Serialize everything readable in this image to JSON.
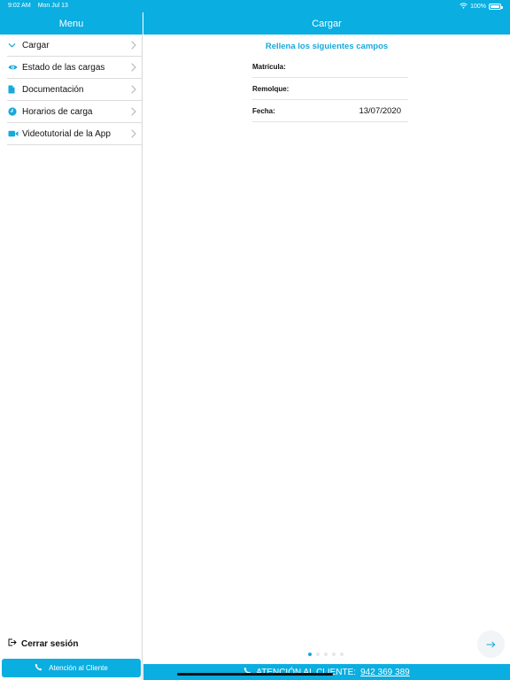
{
  "status_bar": {
    "time": "9:02 AM",
    "date": "Mon Jul 13",
    "battery": "100%"
  },
  "sidebar": {
    "title": "Menu",
    "items": [
      {
        "label": "Cargar",
        "icon": "chevron-down-icon"
      },
      {
        "label": "Estado de las cargas",
        "icon": "eye-icon"
      },
      {
        "label": "Documentación",
        "icon": "document-icon"
      },
      {
        "label": "Horarios de carga",
        "icon": "clock-icon"
      },
      {
        "label": "Videotutorial de la App",
        "icon": "video-camera-icon"
      }
    ],
    "logout_label": "Cerrar sesión",
    "support_label": "Atención al Cliente"
  },
  "main": {
    "title": "Cargar",
    "form_title": "Rellena los siguientes campos",
    "fields": [
      {
        "label": "Matrícula:",
        "value": ""
      },
      {
        "label": "Remolque:",
        "value": ""
      },
      {
        "label": "Fecha:",
        "value": "13/07/2020"
      }
    ],
    "pager": {
      "current_page": 1,
      "total_pages": 5
    }
  },
  "bottom_bar": {
    "label": "ATENCIÓN AL CLIENTE:",
    "phone": "942 369 389"
  },
  "colors": {
    "accent": "#0aaee0",
    "title_text": "#17a8dc"
  }
}
